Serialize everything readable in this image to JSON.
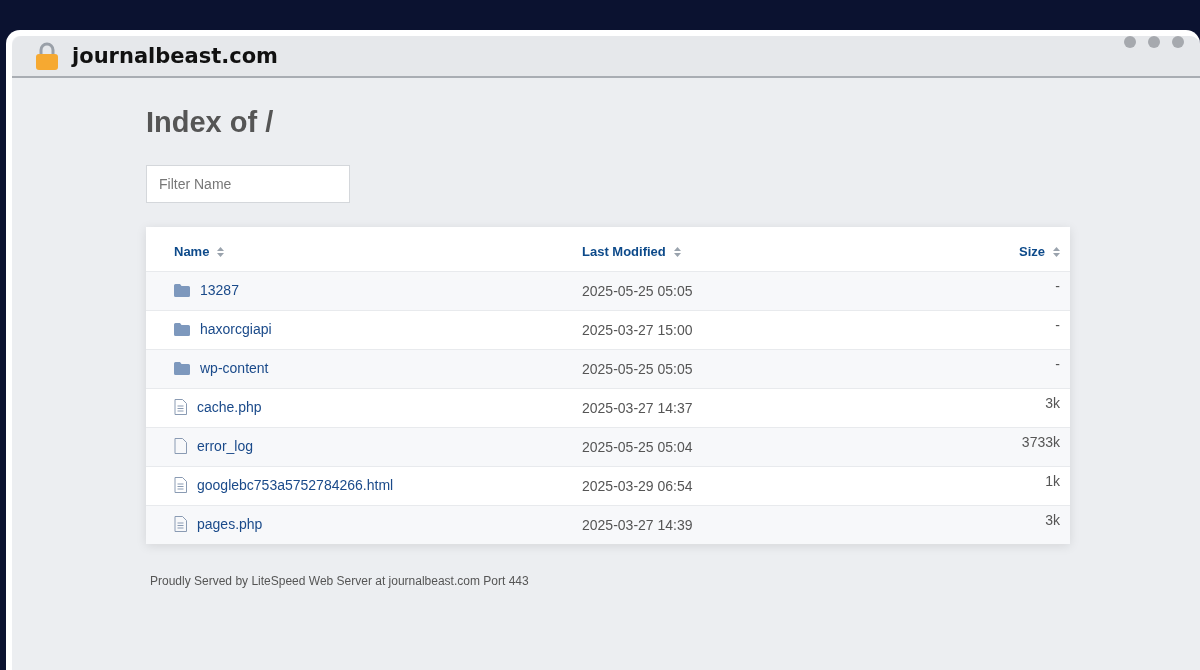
{
  "address_bar": {
    "url": "journalbeast.com"
  },
  "page": {
    "heading": "Index of /",
    "filter": {
      "placeholder": "Filter Name"
    },
    "table": {
      "columns": [
        {
          "label": "Name"
        },
        {
          "label": "Last Modified"
        },
        {
          "label": "Size"
        }
      ],
      "rows": [
        {
          "kind": "folder",
          "name": "13287",
          "modified": "2025-05-25 05:05",
          "size": "-"
        },
        {
          "kind": "folder",
          "name": "haxorcgiapi",
          "modified": "2025-03-27 15:00",
          "size": "-"
        },
        {
          "kind": "folder",
          "name": "wp-content",
          "modified": "2025-05-25 05:05",
          "size": "-"
        },
        {
          "kind": "text",
          "name": "cache.php",
          "modified": "2025-03-27 14:37",
          "size": "3k"
        },
        {
          "kind": "blank",
          "name": "error_log",
          "modified": "2025-05-25 05:04",
          "size": "3733k"
        },
        {
          "kind": "text",
          "name": "googlebc753a5752784266.html",
          "modified": "2025-03-29 06:54",
          "size": "1k"
        },
        {
          "kind": "text",
          "name": "pages.php",
          "modified": "2025-03-27 14:39",
          "size": "3k"
        }
      ]
    },
    "footer": "Proudly Served by LiteSpeed Web Server at journalbeast.com Port 443"
  }
}
